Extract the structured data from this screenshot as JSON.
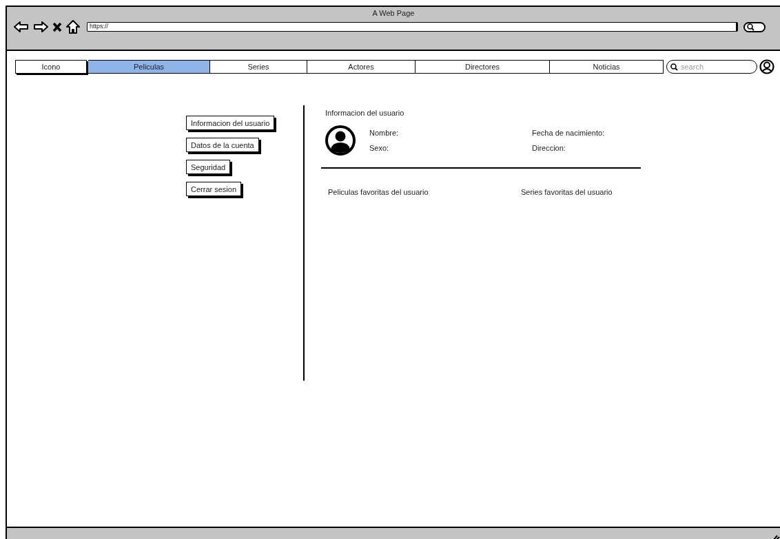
{
  "window": {
    "title": "A Web Page",
    "url": "https://"
  },
  "nav": {
    "items": [
      {
        "label": "Icono",
        "selected": false
      },
      {
        "label": "Peliculas",
        "selected": true
      },
      {
        "label": "Series",
        "selected": false
      },
      {
        "label": "Actores",
        "selected": false
      },
      {
        "label": "Directores",
        "selected": false
      },
      {
        "label": "Noticias",
        "selected": false
      }
    ],
    "search": {
      "placeholder": "search"
    }
  },
  "sidebar": {
    "buttons": [
      "Informacion del usuario",
      "Datos de la cuenta",
      "Seguridad",
      "Cerrar sesion"
    ]
  },
  "profile": {
    "title": "Informacion del usuario",
    "fields": [
      "Nombre:",
      "Fecha de nacimiento:",
      "Sexo:",
      "Direccion:"
    ]
  },
  "favorites": [
    "Peliculas favoritas del usuario",
    "Series favoritas del usuario"
  ]
}
